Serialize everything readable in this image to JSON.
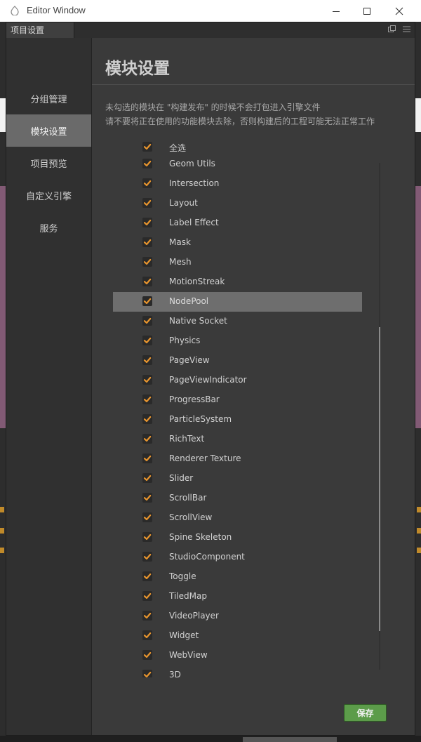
{
  "window": {
    "title": "Editor Window"
  },
  "panel": {
    "tab_label": "项目设置"
  },
  "sidebar": {
    "items": [
      {
        "label": "分组管理",
        "active": false
      },
      {
        "label": "模块设置",
        "active": true
      },
      {
        "label": "项目预览",
        "active": false
      },
      {
        "label": "自定义引擎",
        "active": false
      },
      {
        "label": "服务",
        "active": false
      }
    ]
  },
  "main": {
    "title": "模块设置",
    "desc_line1": "未勾选的模块在 \"构建发布\" 的时候不会打包进入引擎文件",
    "desc_line2": "请不要将正在使用的功能模块去除，否则构建后的工程可能无法正常工作",
    "select_all_label": "全选",
    "save_label": "保存",
    "accent_color": "#e8952e",
    "modules": [
      {
        "label": "Geom Utils",
        "checked": true,
        "highlighted": false
      },
      {
        "label": "Intersection",
        "checked": true,
        "highlighted": false
      },
      {
        "label": "Layout",
        "checked": true,
        "highlighted": false
      },
      {
        "label": "Label Effect",
        "checked": true,
        "highlighted": false
      },
      {
        "label": "Mask",
        "checked": true,
        "highlighted": false
      },
      {
        "label": "Mesh",
        "checked": true,
        "highlighted": false
      },
      {
        "label": "MotionStreak",
        "checked": true,
        "highlighted": false
      },
      {
        "label": "NodePool",
        "checked": true,
        "highlighted": true
      },
      {
        "label": "Native Socket",
        "checked": true,
        "highlighted": false
      },
      {
        "label": "Physics",
        "checked": true,
        "highlighted": false
      },
      {
        "label": "PageView",
        "checked": true,
        "highlighted": false
      },
      {
        "label": "PageViewIndicator",
        "checked": true,
        "highlighted": false
      },
      {
        "label": "ProgressBar",
        "checked": true,
        "highlighted": false
      },
      {
        "label": "ParticleSystem",
        "checked": true,
        "highlighted": false
      },
      {
        "label": "RichText",
        "checked": true,
        "highlighted": false
      },
      {
        "label": "Renderer Texture",
        "checked": true,
        "highlighted": false
      },
      {
        "label": "Slider",
        "checked": true,
        "highlighted": false
      },
      {
        "label": "ScrollBar",
        "checked": true,
        "highlighted": false
      },
      {
        "label": "ScrollView",
        "checked": true,
        "highlighted": false
      },
      {
        "label": "Spine Skeleton",
        "checked": true,
        "highlighted": false
      },
      {
        "label": "StudioComponent",
        "checked": true,
        "highlighted": false
      },
      {
        "label": "Toggle",
        "checked": true,
        "highlighted": false
      },
      {
        "label": "TiledMap",
        "checked": true,
        "highlighted": false
      },
      {
        "label": "VideoPlayer",
        "checked": true,
        "highlighted": false
      },
      {
        "label": "Widget",
        "checked": true,
        "highlighted": false
      },
      {
        "label": "WebView",
        "checked": true,
        "highlighted": false
      },
      {
        "label": "3D",
        "checked": true,
        "highlighted": false
      }
    ]
  }
}
